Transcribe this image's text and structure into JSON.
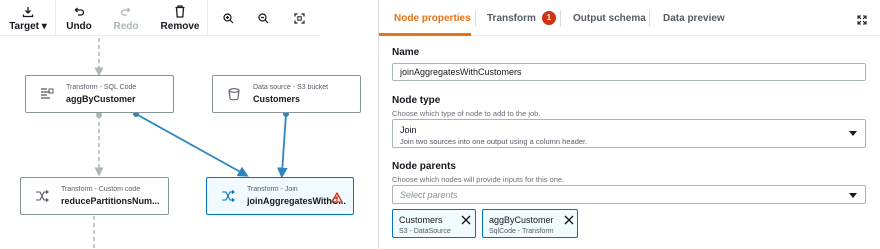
{
  "toolbar": {
    "target": "Target",
    "undo": "Undo",
    "redo": "Redo",
    "remove": "Remove"
  },
  "nodes": [
    {
      "id": "aggByCustomer",
      "type_label": "Transform - SQL Code",
      "name": "aggByCustomer",
      "icon": "sql-code-icon"
    },
    {
      "id": "customers",
      "type_label": "Data source - S3 bucket",
      "name": "Customers",
      "icon": "s3-bucket-icon"
    },
    {
      "id": "reducePartitions",
      "type_label": "Transform - Custom code",
      "name": "reducePartitionsNum...",
      "icon": "custom-code-icon"
    },
    {
      "id": "joinAggregates",
      "type_label": "Transform - Join",
      "name": "joinAggregatesWithC...",
      "icon": "join-icon",
      "selected": true,
      "warning": "warning-icon"
    }
  ],
  "colors": {
    "accent": "#ec7211",
    "selection": "#0073bb",
    "error": "#d13212",
    "edge": "#2e86c1",
    "dashed_edge": "#aab7b8"
  },
  "panel": {
    "tabs": [
      {
        "label": "Node properties",
        "active": true
      },
      {
        "label": "Transform",
        "badge": "1"
      },
      {
        "label": "Output schema"
      },
      {
        "label": "Data preview"
      }
    ],
    "name": {
      "label": "Name",
      "value": "joinAggregatesWithCustomers"
    },
    "node_type": {
      "label": "Node type",
      "description": "Choose which type of node to add to the job.",
      "value": "Join",
      "value_description": "Join two sources into one output using a column header."
    },
    "node_parents": {
      "label": "Node parents",
      "description": "Choose which nodes will provide inputs for this one.",
      "placeholder": "Select parents",
      "selected": [
        {
          "name": "Customers",
          "sub": "S3 - DataSource"
        },
        {
          "name": "aggByCustomer",
          "sub": "SqlCode - Transform"
        }
      ]
    }
  }
}
